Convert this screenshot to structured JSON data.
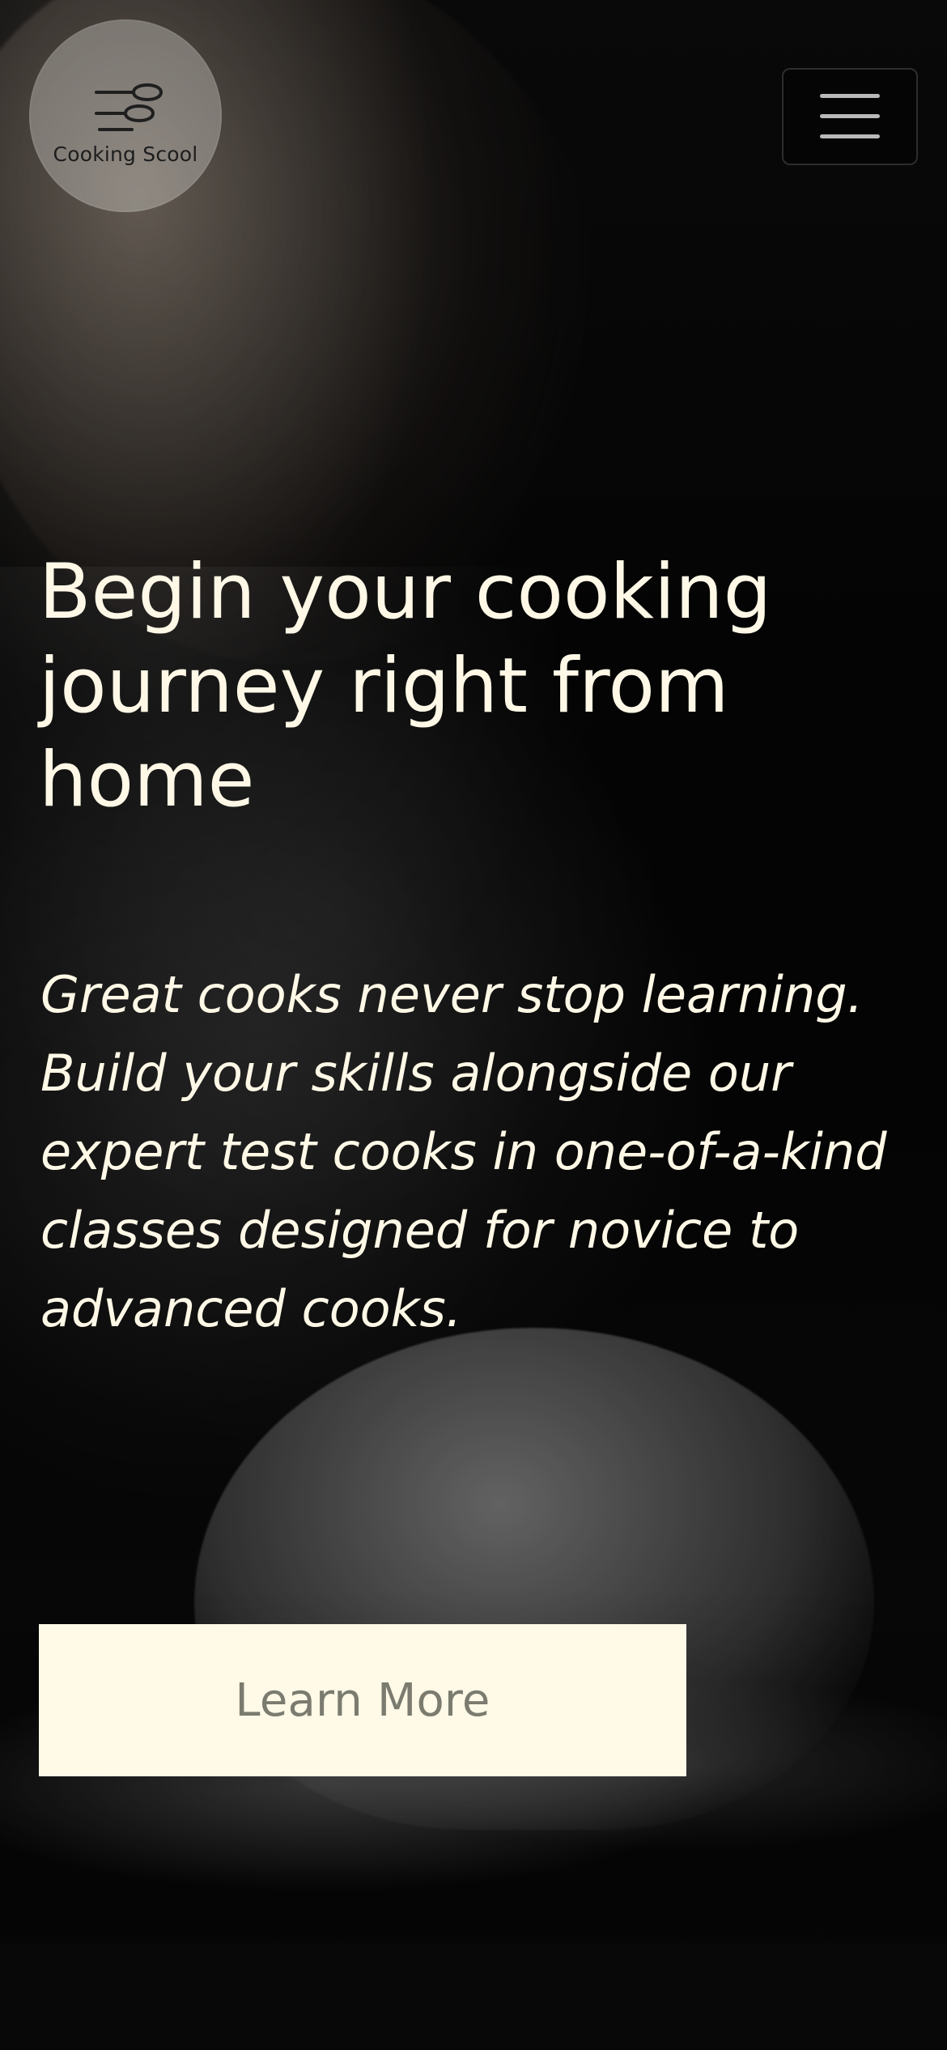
{
  "brand": {
    "logo_text": "Cooking Scool",
    "logo_icon": "measuring-spoons-icon"
  },
  "header": {
    "menu_icon": "hamburger-menu-icon"
  },
  "hero": {
    "headline": "Begin your cooking journey right from home",
    "description": "Great cooks never stop learning. Build your skills alongside our expert test cooks in one-of-a-kind classes designed for novice to advanced cooks.",
    "cta_label": "Learn More"
  },
  "colors": {
    "text_primary": "#FFF8E6",
    "cta_background": "#FFF9E7",
    "cta_text": "#7B7B6F",
    "logo_background": "rgba(230,226,220,0.35)",
    "page_background": "#050505"
  }
}
